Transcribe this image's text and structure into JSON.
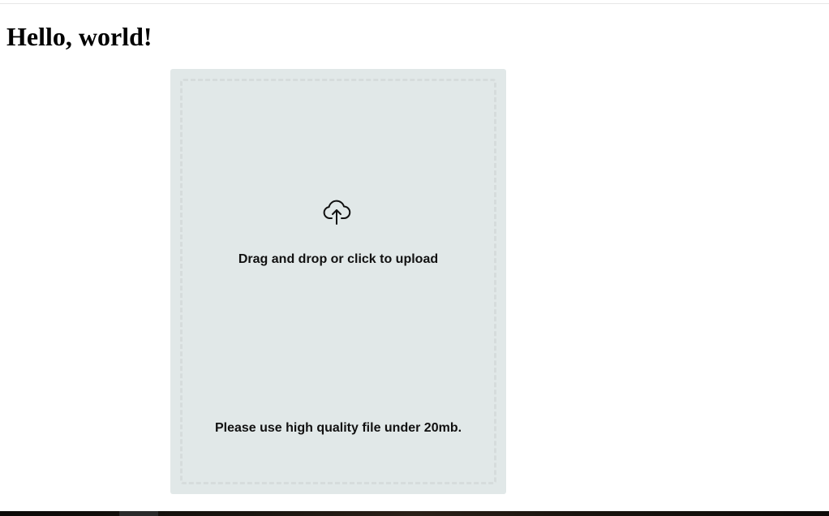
{
  "page": {
    "title": "Hello, world!"
  },
  "uploader": {
    "icon": "cloud-upload-icon",
    "prompt": "Drag and drop or click to upload",
    "hint": "Please use high quality file under 20mb.",
    "colors": {
      "card_background": "#e1e8e8",
      "dashed_border": "#d6dcdc",
      "text": "#111111"
    }
  }
}
